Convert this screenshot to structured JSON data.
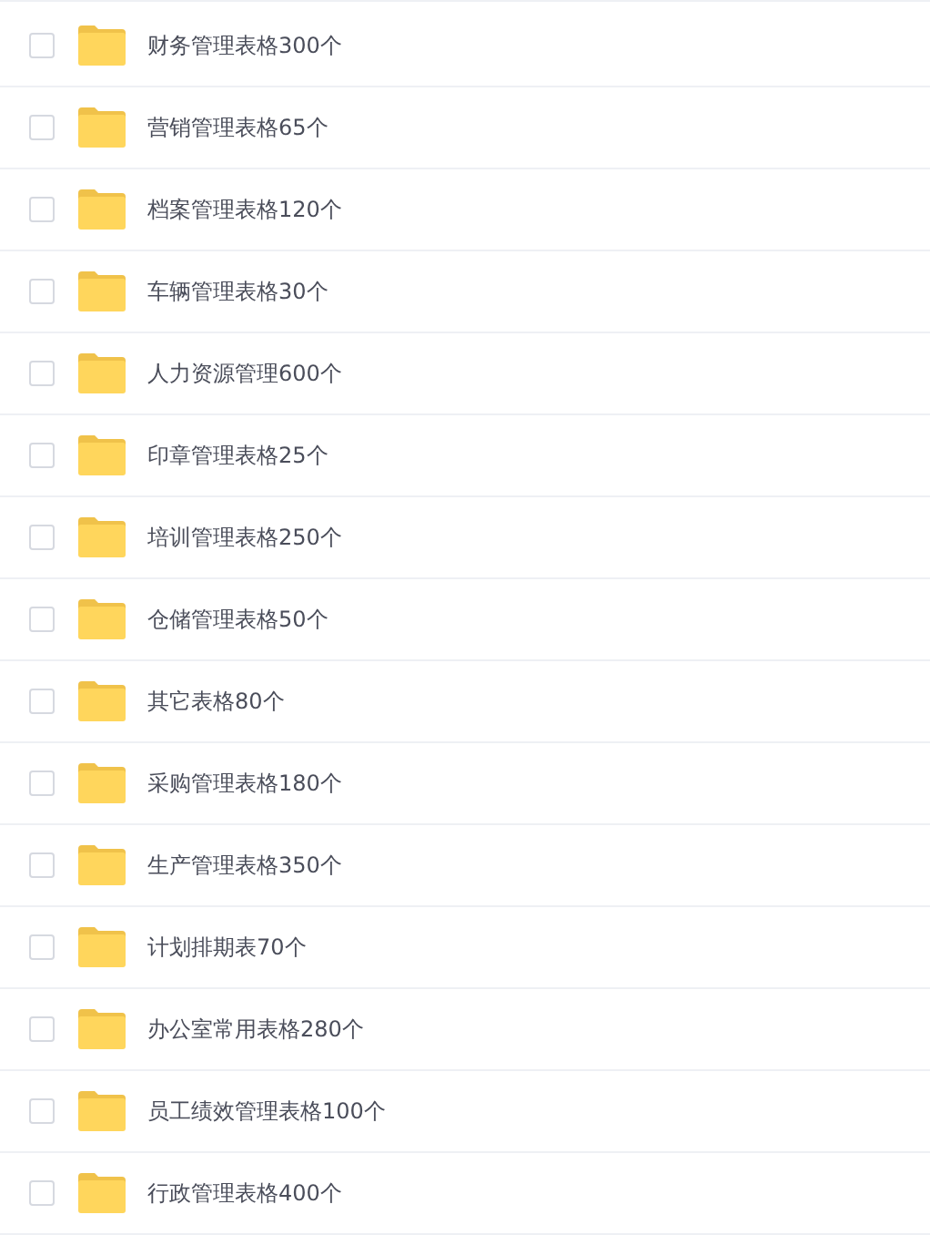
{
  "folders": [
    {
      "name": "财务管理表格300个",
      "checked": false
    },
    {
      "name": "营销管理表格65个",
      "checked": false
    },
    {
      "name": "档案管理表格120个",
      "checked": false
    },
    {
      "name": "车辆管理表格30个",
      "checked": false
    },
    {
      "name": "人力资源管理600个",
      "checked": false
    },
    {
      "name": "印章管理表格25个",
      "checked": false
    },
    {
      "name": "培训管理表格250个",
      "checked": false
    },
    {
      "name": "仓储管理表格50个",
      "checked": false
    },
    {
      "name": "其它表格80个",
      "checked": false
    },
    {
      "name": "采购管理表格180个",
      "checked": false
    },
    {
      "name": "生产管理表格350个",
      "checked": false
    },
    {
      "name": "计划排期表70个",
      "checked": false
    },
    {
      "name": "办公室常用表格280个",
      "checked": false
    },
    {
      "name": "员工绩效管理表格100个",
      "checked": false
    },
    {
      "name": "行政管理表格400个",
      "checked": false
    }
  ]
}
